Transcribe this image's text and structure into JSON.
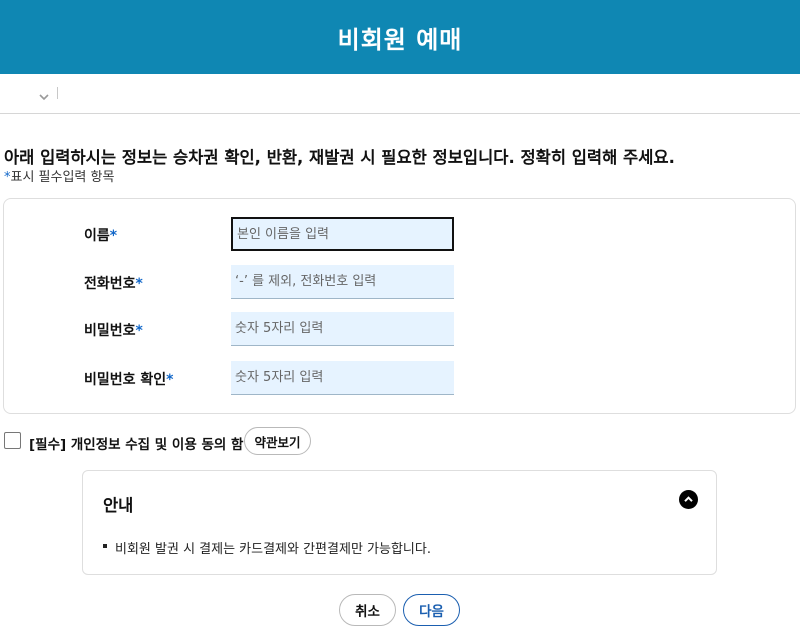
{
  "header": {
    "title": "비회원 예매"
  },
  "subbar": {
    "dropdown_icon": "chevron-down-icon"
  },
  "intro": {
    "text": "아래 입력하시는 정보는 승차권 확인, 반환, 재발권 시 필요한 정보입니다. 정확히 입력해 주세요.",
    "required_mark": "*",
    "required_note": "표시 필수입력 항목"
  },
  "form": {
    "fields": [
      {
        "label": "이름",
        "required": "*",
        "placeholder": "본인 이름을 입력",
        "value": ""
      },
      {
        "label": "전화번호",
        "required": "*",
        "placeholder": "‘-’ 를 제외, 전화번호 입력",
        "value": ""
      },
      {
        "label": "비밀번호",
        "required": "*",
        "placeholder": "숫자 5자리 입력",
        "value": ""
      },
      {
        "label": "비밀번호 확인",
        "required": "*",
        "placeholder": "숫자 5자리 입력",
        "value": ""
      }
    ]
  },
  "agreement": {
    "label": "[필수] 개인정보 수집 및 이용 동의 함",
    "checked": false,
    "terms_button": "약관보기"
  },
  "info": {
    "title": "안내",
    "collapse_icon": "chevron-up-icon",
    "items": [
      "비회원 발권 시 결제는 카드결제와 간편결제만 가능합니다."
    ]
  },
  "buttons": {
    "cancel": "취소",
    "next": "다음"
  },
  "colors": {
    "header_bg": "#0f87b3",
    "accent": "#1066c8",
    "input_bg": "#e6f3ff",
    "next_button": "#1b5fb0"
  }
}
